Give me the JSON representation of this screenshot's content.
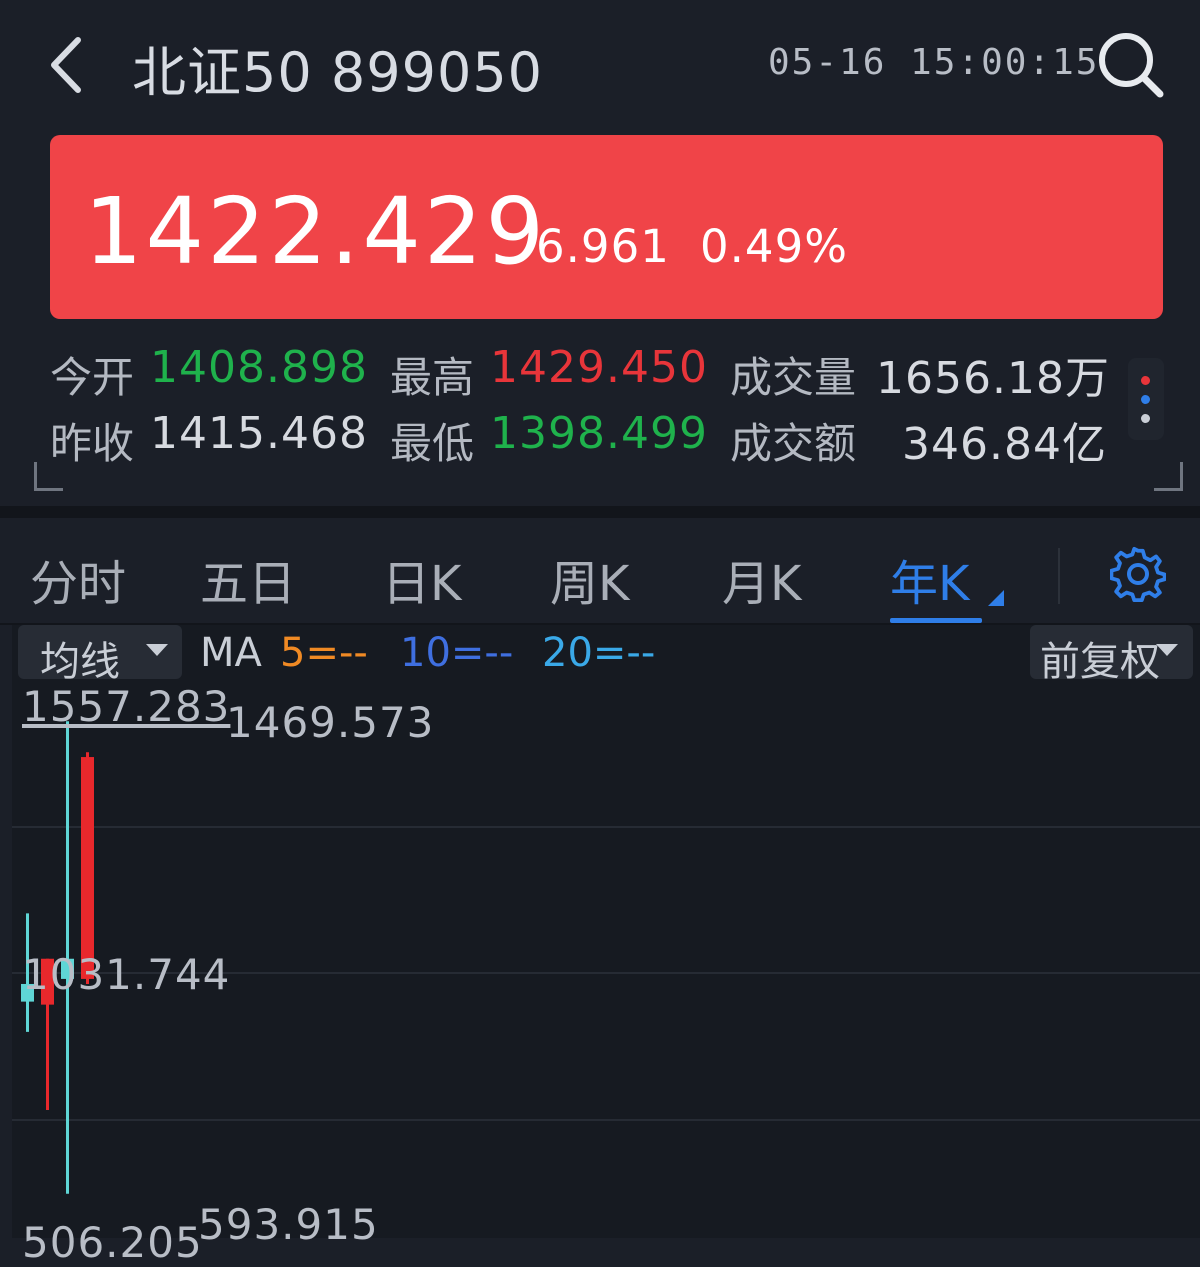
{
  "header": {
    "title": "北证50",
    "code": "899050",
    "timestamp": "05-16 15:00:15"
  },
  "quote": {
    "price": "1422.429",
    "change": "6.961",
    "change_pct": "0.49%",
    "banner_color": "#f04448"
  },
  "stats": {
    "open_label": "今开",
    "open_value": "1408.898",
    "high_label": "最高",
    "high_value": "1429.450",
    "volume_label": "成交量",
    "volume_value": "1656.18万",
    "prev_close_label": "昨收",
    "prev_close_value": "1415.468",
    "low_label": "最低",
    "low_value": "1398.499",
    "turnover_label": "成交额",
    "turnover_value": "346.84亿"
  },
  "tabs": {
    "items": [
      "分时",
      "五日",
      "日K",
      "周K",
      "月K",
      "年K"
    ],
    "active": "年K"
  },
  "indicators": {
    "ma_dropdown": "均线",
    "ma_label": "MA",
    "ma5": "5=--",
    "ma10": "10=--",
    "ma20": "20=--",
    "adjust": "前复权",
    "colors": {
      "ma5": "#f08a24",
      "ma10": "#3f6fe0",
      "ma20": "#3aa9e8",
      "up": "#e8282c",
      "down": "#5fd6d6"
    }
  },
  "chart_labels": {
    "axis_top": "1557.283",
    "axis_mid": "1031.744",
    "axis_bottom": "506.205",
    "max_marker": "1469.573",
    "min_marker": "593.915"
  },
  "chart_data": {
    "type": "candlestick",
    "title": "",
    "ylim": [
      506.205,
      1557.283
    ],
    "candles": [
      {
        "open": 1010,
        "close": 975,
        "high": 1150,
        "low": 915,
        "direction": "down"
      },
      {
        "open": 969,
        "close": 1060,
        "high": 1060,
        "low": 760,
        "direction": "up"
      },
      {
        "open": 1060,
        "close": 1020,
        "high": 1531,
        "low": 593.915,
        "direction": "down"
      },
      {
        "open": 1020,
        "close": 1460,
        "high": 1469.573,
        "low": 1010,
        "direction": "up"
      }
    ]
  }
}
